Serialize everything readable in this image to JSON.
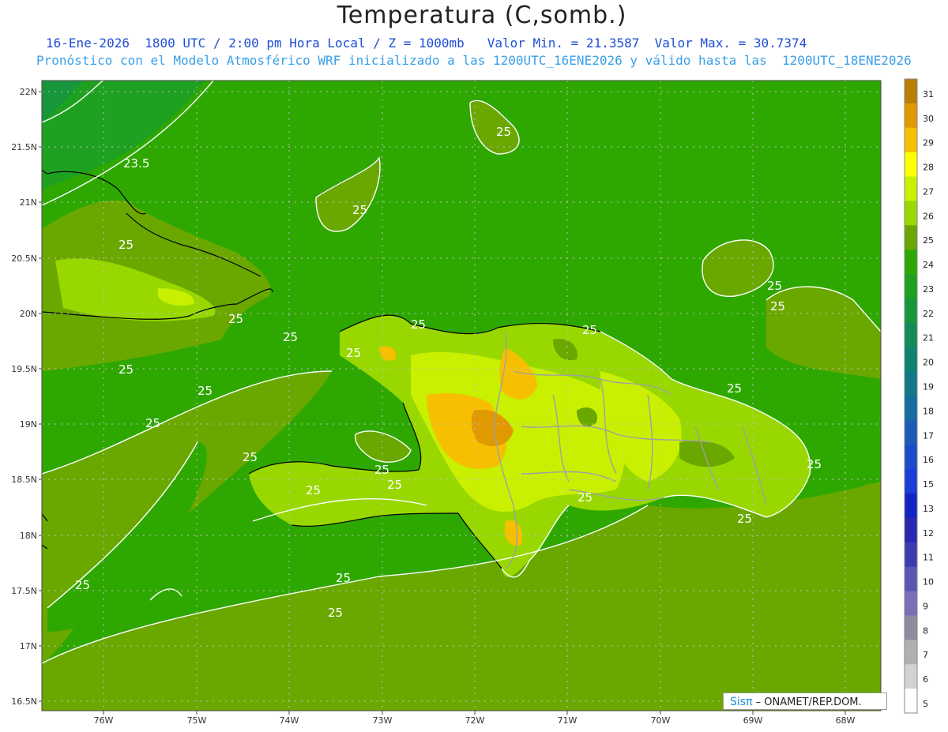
{
  "title": "Temperatura (C,somb.)",
  "subtitle_line1": "16-Ene-2026  1800 UTC / 2:00 pm Hora Local / Z = 1000mb   Valor Min. = 21.3587  Valor Max. = 30.7374",
  "subtitle_line2": "Pronóstico con el Modelo Atmosférico WRF inicializado a las 1200UTC_16ENE2026 y válido hasta las  1200UTC_18ENE2026",
  "lat_labels": [
    "22N",
    "21.5N",
    "21N",
    "20.5N",
    "20N",
    "19.5N",
    "19N",
    "18.5N",
    "18N",
    "17.5N",
    "17N",
    "16.5N"
  ],
  "lon_labels": [
    "76W",
    "75W",
    "74W",
    "73W",
    "72W",
    "71W",
    "70W",
    "69W",
    "68W"
  ],
  "colorbar": {
    "labels": [
      "31",
      "30",
      "29",
      "28",
      "27",
      "26",
      "25",
      "24",
      "23",
      "22",
      "21",
      "20",
      "19",
      "18",
      "17",
      "16",
      "15",
      "13",
      "12",
      "11",
      "10",
      "9",
      "8",
      "7",
      "6",
      "5"
    ],
    "colors": [
      "#b87f00",
      "#e09a00",
      "#f6c000",
      "#ffff00",
      "#c8f000",
      "#98d800",
      "#6aa800",
      "#2ea800",
      "#1ea020",
      "#17963c",
      "#0f8c58",
      "#0b8470",
      "#107888",
      "#146ca0",
      "#1a5cb8",
      "#1a4cc8",
      "#1a3cd8",
      "#1224c4",
      "#2828b0",
      "#3c3cb0",
      "#5858b4",
      "#7a6eb8",
      "#8c8c9c",
      "#b0b0b0",
      "#d2d2d2",
      "#ffffff"
    ]
  },
  "contour_labels": [
    "23.5",
    "25",
    "25",
    "25",
    "25",
    "25",
    "25",
    "25",
    "25",
    "25",
    "25",
    "25",
    "25",
    "25",
    "25",
    "25",
    "25",
    "25",
    "25",
    "25",
    "25",
    "25",
    "25",
    "25",
    "25"
  ],
  "credit": {
    "brand": "Sisπ",
    "org": "– ONAMET/REP.DOM."
  },
  "colors": {
    "sea": "#2ea800",
    "land_low": "#6aa800",
    "land_mid": "#98d800",
    "land_warm": "#c8f000",
    "land_hot": "#f6c000",
    "land_peak": "#e09a00",
    "contour": "#ffffff",
    "border": "#a0a0a0"
  }
}
